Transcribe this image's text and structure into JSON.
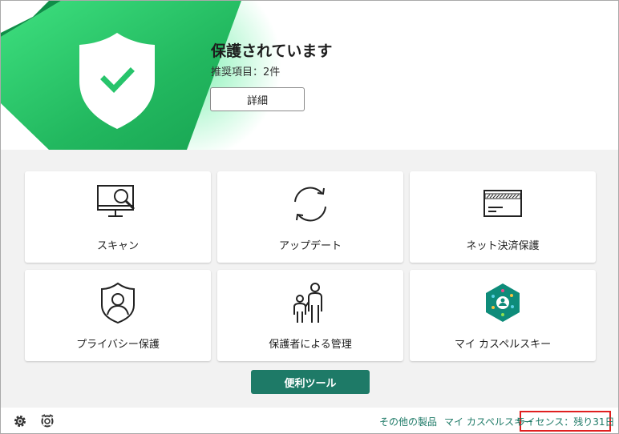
{
  "status": {
    "title": "保護されています",
    "recommendations": "推奨項目：2件",
    "details_label": "詳細",
    "accent": "#1e7a67",
    "shield_green": "#27c46b"
  },
  "tiles": [
    {
      "label": "スキャン",
      "icon": "scan-monitor-icon"
    },
    {
      "label": "アップデート",
      "icon": "update-arrows-icon"
    },
    {
      "label": "ネット決済保護",
      "icon": "credit-card-icon"
    },
    {
      "label": "プライバシー保護",
      "icon": "privacy-shield-icon"
    },
    {
      "label": "保護者による管理",
      "icon": "parent-child-icon"
    },
    {
      "label": "マイ カスペルスキー",
      "icon": "my-kaspersky-icon"
    }
  ],
  "tools_label": "便利ツール",
  "footer": {
    "other_products": "その他の製品",
    "my_kaspersky": "マイ カスペルスキー",
    "license": "ライセンス：残り31日",
    "license_highlight": "#e02020"
  }
}
